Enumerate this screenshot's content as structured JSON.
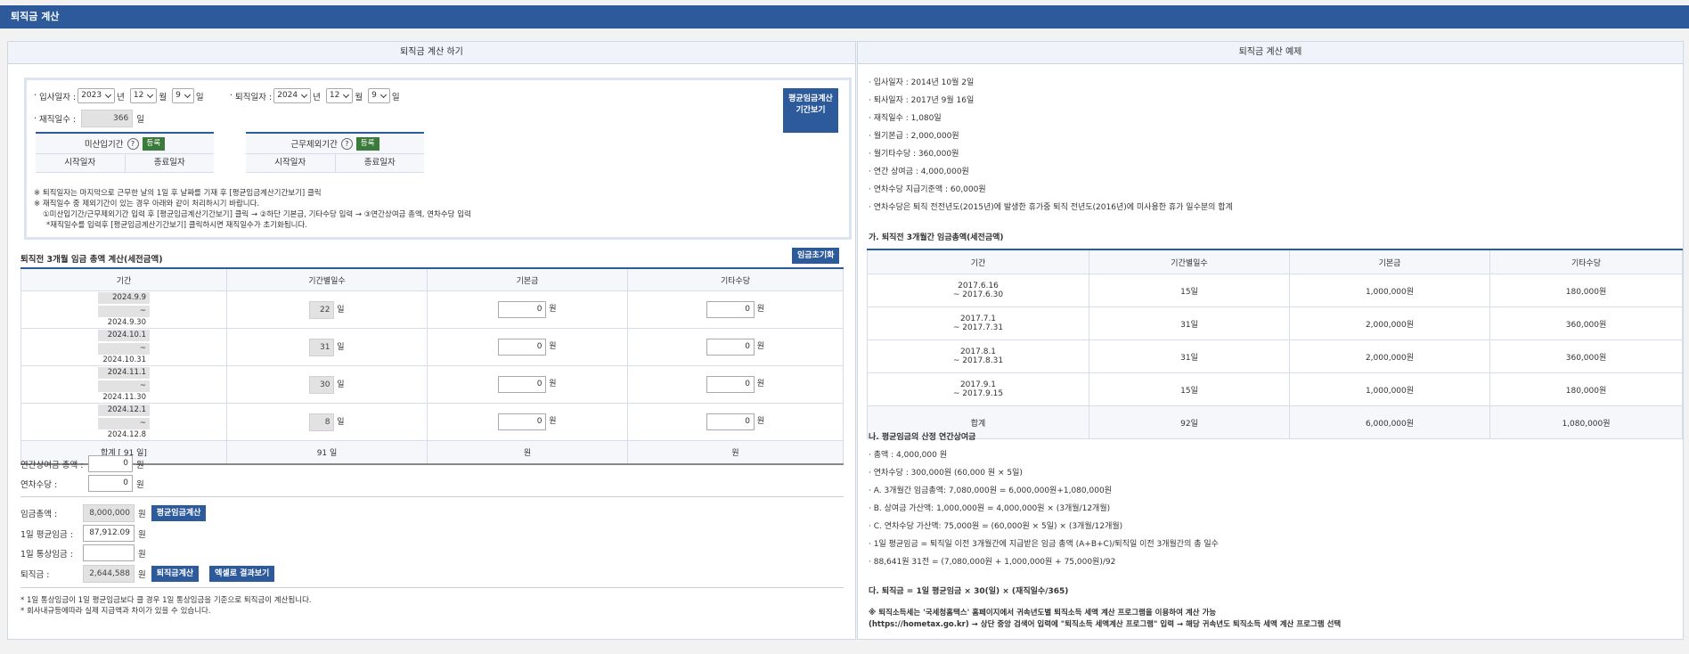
{
  "window": {
    "title": "퇴직금 계산"
  },
  "left": {
    "header": "퇴직금 계산 하기",
    "join": {
      "label": "입사일자 :",
      "year": "2023",
      "year_unit": "년",
      "month": "12",
      "month_unit": "월",
      "day": "9",
      "day_unit": "일"
    },
    "leave": {
      "label": "퇴직일자 :",
      "year": "2024",
      "year_unit": "년",
      "month": "12",
      "month_unit": "월",
      "day": "9",
      "day_unit": "일"
    },
    "work_days": {
      "label": "재직일수 :",
      "value": "366",
      "unit": "일"
    },
    "avg_period_button": "평균임금계산 기간보기",
    "exclusion_boxes": [
      {
        "title": "미산입기간",
        "register": "등록",
        "start": "시작일자",
        "end": "종료일자"
      },
      {
        "title": "근무제외기간",
        "register": "등록",
        "start": "시작일자",
        "end": "종료일자"
      }
    ],
    "notes": [
      "※ 퇴직일자는 마지막으로 근무한 날의 1일 후 날짜를 기재 후 [평균임금계산기간보기] 클릭",
      "※ 재직일수 중 제외기간이 있는 경우 아래와 같이 처리하시기 바랍니다.",
      "①미산입기간/근무제외기간 입력 후 [평균임금계산기간보기] 클릭 → ②하단 기본급, 기타수당 입력 → ③연간상여금 총액, 연차수당 입력",
      "*재직일수를 입력후 [평균임금계산기간보기] 클릭하시면 재직일수가 초기화됩니다."
    ],
    "section_title": "퇴직전 3개월 임금 총액 계산(세전금액)",
    "reset_button": "임금초기화",
    "table": {
      "headers": [
        "기간",
        "기간별일수",
        "기본금",
        "기타수당"
      ],
      "rows": [
        {
          "from": "2024.9.9",
          "to": "~ 2024.9.30",
          "days": "22",
          "base": "0",
          "etc": "0"
        },
        {
          "from": "2024.10.1",
          "to": "~ 2024.10.31",
          "days": "31",
          "base": "0",
          "etc": "0"
        },
        {
          "from": "2024.11.1",
          "to": "~ 2024.11.30",
          "days": "30",
          "base": "0",
          "etc": "0"
        },
        {
          "from": "2024.12.1",
          "to": "~ 2024.12.8",
          "days": "8",
          "base": "0",
          "etc": "0"
        }
      ],
      "day_unit": "일",
      "won_unit": "원",
      "total": {
        "label": "합계 [    91  일]",
        "days": "91",
        "day_unit": "일",
        "base_unit": "원",
        "etc_unit": "원"
      }
    },
    "bonus": {
      "label": "연간상여금 총액 :",
      "value": "0",
      "unit": "원"
    },
    "annual_leave": {
      "label": "연차수당 :",
      "value": "0",
      "unit": "원"
    },
    "total_wage": {
      "label": "임금총액 :",
      "value": "8,000,000",
      "unit": "원",
      "button": "평균임금계산"
    },
    "daily_avg": {
      "label": "1일 평균임금 :",
      "value": "87,912.09",
      "unit": "원"
    },
    "daily_normal": {
      "label": "1일 통상임금 :",
      "value": "",
      "unit": "원"
    },
    "severance": {
      "label": "퇴직금 :",
      "value": "2,644,588",
      "unit": "원",
      "button": "퇴직금계산",
      "excel_button": "엑셀로 결과보기"
    },
    "footnotes": [
      "* 1일 통상임금이 1일 평균임금보다 클 경우 1일 통상임금을 기준으로 퇴직금이 계산됩니다.",
      "* 회사내규등에따라 실제 지급액과 차이가 있을 수 있습니다."
    ]
  },
  "right": {
    "header": "퇴직금 계산 예제",
    "facts": [
      "입사일자 : 2014년 10월 2일",
      "퇴사일자 : 2017년 9월 16일",
      "재직일수 : 1,080일",
      "월기본급 : 2,000,000원",
      "월기타수당 : 360,000원",
      "연간 상여금 : 4,000,000원",
      "연차수당 지급기준액 : 60,000원",
      "연차수당은 퇴직 전전년도(2015년)에 발생한 휴가중 퇴직 전년도(2016년)에 미사용한 휴가 일수분의 합계"
    ],
    "section_a": "가. 퇴직전 3개월간 임금총액(세전금액)",
    "table": {
      "headers": [
        "기간",
        "기간별일수",
        "기본금",
        "기타수당"
      ],
      "rows": [
        {
          "from": "2017.6.16",
          "to": "~ 2017.6.30",
          "days": "15일",
          "base": "1,000,000원",
          "etc": "180,000원"
        },
        {
          "from": "2017.7.1",
          "to": "~ 2017.7.31",
          "days": "31일",
          "base": "2,000,000원",
          "etc": "360,000원"
        },
        {
          "from": "2017.8.1",
          "to": "~ 2017.8.31",
          "days": "31일",
          "base": "2,000,000원",
          "etc": "360,000원"
        },
        {
          "from": "2017.9.1",
          "to": "~ 2017.9.15",
          "days": "15일",
          "base": "1,000,000원",
          "etc": "180,000원"
        }
      ],
      "total": {
        "label": "합계",
        "days": "92일",
        "base": "6,000,000원",
        "etc": "1,080,000원"
      }
    },
    "section_b": "나. 평균임금의 산정 연간상여금",
    "calc_lines": [
      "총액 : 4,000,000 원",
      "연차수당 : 300,000원 (60,000 원 × 5일)",
      "A. 3개월간 임금총액: 7,080,000원 = 6,000,000원+1,080,000원",
      "B. 상여금 가산액: 1,000,000원 = 4,000,000원 × (3개월/12개월)",
      "C. 연차수당 가산액: 75,000원 = (60,000원 × 5일) × (3개월/12개월)",
      "1일 평균임금 = 퇴직일 이전 3개월간에 지급받은 임금 총액 (A+B+C)/퇴직일 이전 3개월간의 총 일수",
      "88,641원 31전 = (7,080,000원 + 1,000,000원 + 75,000원)/92"
    ],
    "section_c": "다. 퇴직금 = 1일 평균임금 × 30(일) × (재직일수/365)",
    "tax_note_1": "※ 퇴직소득세는 '국세청홈택스' 홈페이지에서 귀속년도별 퇴직소득 세액 계산 프로그램을 이용하여 계산 가능",
    "tax_note_2": "(https://hometax.go.kr) → 상단 중앙 검색어 입력에 \"퇴직소득 세액계산 프로그램\" 입력 → 해당 귀속년도 퇴직소득 세액 계산 프로그램 선택"
  }
}
